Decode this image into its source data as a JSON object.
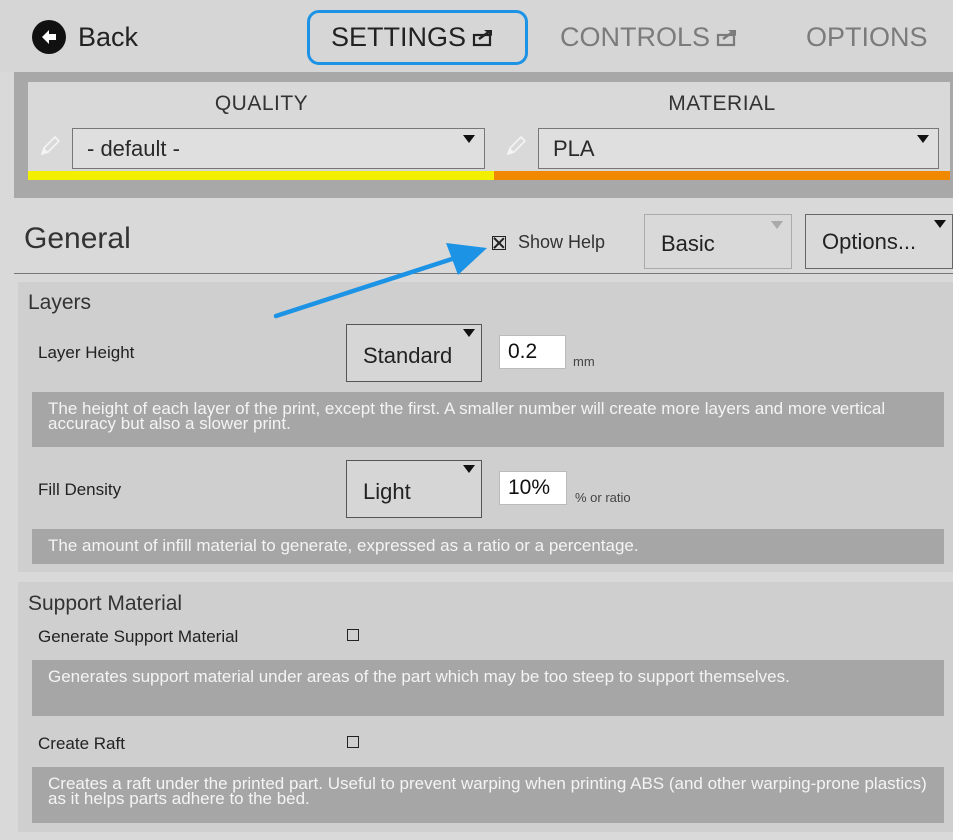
{
  "header": {
    "back_label": "Back",
    "tabs": [
      {
        "label": "SETTINGS",
        "active": true
      },
      {
        "label": "CONTROLS",
        "active": false
      },
      {
        "label": "OPTIONS",
        "active": false
      }
    ],
    "highlight_color": "#1d93e6"
  },
  "presets": {
    "quality": {
      "title": "QUALITY",
      "value": "- default -",
      "color": "#f2f000"
    },
    "material": {
      "title": "MATERIAL",
      "value": "PLA",
      "color": "#f08800"
    }
  },
  "general": {
    "title": "General",
    "show_help_label": "Show Help",
    "show_help_checked": true,
    "mode_value": "Basic",
    "options_label": "Options..."
  },
  "layers": {
    "title": "Layers",
    "layer_height": {
      "label": "Layer Height",
      "preset": "Standard",
      "value": "0.2",
      "unit": "mm",
      "help": "The height of each layer of the print, except the first. A smaller number will create more layers and more vertical accuracy but also a slower print."
    },
    "fill_density": {
      "label": "Fill Density",
      "preset": "Light",
      "value": "10%",
      "unit": "% or ratio",
      "help": "The amount of infill material to generate, expressed as a ratio or a percentage."
    }
  },
  "support": {
    "title": "Support Material",
    "generate_support": {
      "label": "Generate Support Material",
      "checked": false,
      "help": "Generates support material under areas of the part which may be too steep to support themselves."
    },
    "create_raft": {
      "label": "Create Raft",
      "checked": false,
      "help": "Creates a raft under the printed part. Useful to prevent warping when printing ABS (and other warping-prone plastics) as it helps parts adhere to the bed."
    }
  }
}
